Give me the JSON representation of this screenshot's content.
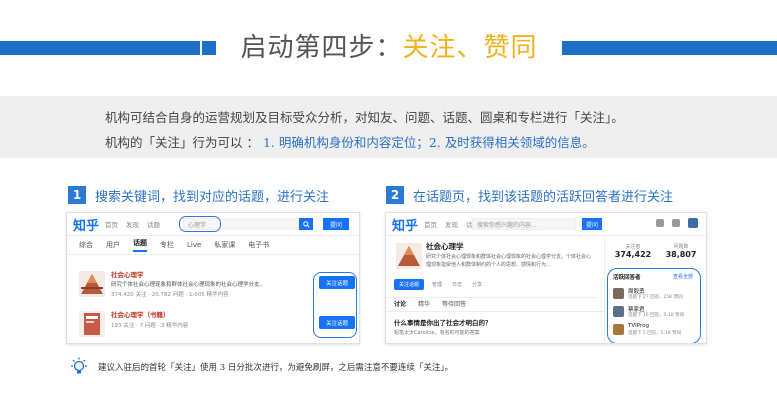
{
  "title": {
    "prefix": "启动第四步：",
    "highlight": "关注、赞同"
  },
  "description": {
    "line1": "机构可结合自身的运营规划及目标受众分析，对知友、问题、话题、圆桌和专栏进行「关注」。",
    "line2_prefix": "机构的「关注」行为可以 ：",
    "line2_highlight": " 1. 明确机构身份和内容定位；2. 及时获得相关领域的信息。"
  },
  "steps": [
    {
      "num": "1",
      "text": "搜索关键词，找到对应的话题，进行关注"
    },
    {
      "num": "2",
      "text": "在话题页，找到该话题的活跃回答者进行关注"
    }
  ],
  "shot1": {
    "logo": "知乎",
    "nav": [
      "首页",
      "发现",
      "话题"
    ],
    "search_value": "心理学",
    "ask_label": "提问",
    "tabs": [
      "综合",
      "用户",
      "话题",
      "专栏",
      "Live",
      "私家课",
      "电子书"
    ],
    "results": [
      {
        "title": "社会心理学",
        "desc": "研究个体社会心理现象和群体社会心理现象的社会心理学分支。",
        "meta": "374,420 关注 · 20,782 问题 · 1,005 精华内容",
        "button": "关注话题"
      },
      {
        "title": "社会心理学（书籍）",
        "desc": "",
        "meta": "193 关注 · 7 问题 · 3 精华内容",
        "button": "关注话题"
      }
    ]
  },
  "shot2": {
    "logo": "知乎",
    "nav": [
      "首页",
      "发现",
      "话题"
    ],
    "search_placeholder": "搜索你感兴趣的内容...",
    "ask_label": "提问",
    "topic_title": "社会心理学",
    "topic_desc": "研究个体社会心理现象和群体社会心理现象的社会心理学分支。个体社会心理现象指受他人和群体制约的个人的思想、感情和行为...",
    "follow_label": "关注话题",
    "actions": [
      "管理",
      "日志",
      "分享"
    ],
    "sub_tabs": [
      "讨论",
      "精华",
      "等待回答"
    ],
    "question": "什么事情是你出了社会才明白的？",
    "answerer": "铅笔太太Caroline，有名的可能的答案",
    "stats": [
      {
        "label": "关注者",
        "value": "374,422"
      },
      {
        "label": "问题数",
        "value": "38,807"
      }
    ],
    "side_title": "活跃回答者",
    "side_more": "查看全部",
    "answerers": [
      {
        "name": "周毅勇",
        "meta": "话题下 27 回答，25K 赞同"
      },
      {
        "name": "蔡家君",
        "meta": "话题下 10 回答，5.1K 赞同"
      },
      {
        "name": "TVIProg",
        "meta": "话题下 5 回答，5.1K 赞同"
      }
    ]
  },
  "tip": "建议入驻后的首轮「关注」使用 3 日分批次进行，为避免刷屏，之后需注意不要连续「关注」。",
  "colors": {
    "accent": "#1e6fc6",
    "highlight": "#f2b21b",
    "zhihu_blue": "#1772f6"
  },
  "icons": [
    "lightbulb-icon",
    "search-icon"
  ]
}
